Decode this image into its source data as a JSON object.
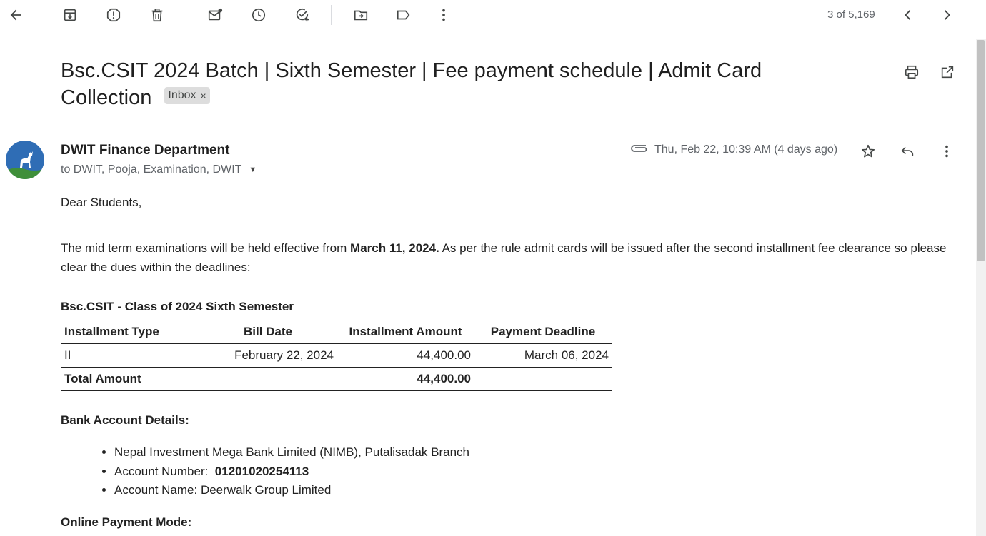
{
  "toolbar": {
    "icons": [
      "back-arrow-icon",
      "archive-icon",
      "report-spam-icon",
      "delete-icon",
      "mark-unread-icon",
      "snooze-icon",
      "add-task-icon",
      "move-to-icon",
      "label-icon",
      "more-vert-icon"
    ],
    "pager_text": "3 of 5,169"
  },
  "email": {
    "subject": "Bsc.CSIT 2024 Batch | Sixth Semester | Fee payment schedule | Admit Card Collection",
    "label": "Inbox",
    "label_close": "×",
    "sender": "DWIT Finance Department",
    "recipients": "to DWIT, Pooja, Examination, DWIT",
    "date": "Thu, Feb 22, 10:39 AM (4 days ago)"
  },
  "content": {
    "greeting": "Dear Students,",
    "para_part1": "The mid term examinations will be held effective from ",
    "para_bold": "March 11, 2024.",
    "para_part2": " As per the rule admit cards will be issued after the second installment fee clearance so please clear the dues within the deadlines:",
    "table_title": "Bsc.CSIT - Class of 2024 Sixth Semester",
    "table": {
      "headers": [
        "Installment Type",
        "Bill Date",
        "Installment Amount",
        "Payment Deadline"
      ],
      "rows": [
        [
          "II",
          "February 22, 2024",
          "44,400.00",
          "March 06, 2024"
        ]
      ],
      "total_label": "Total Amount",
      "total_value": "44,400.00"
    },
    "bank_title": "Bank Account Details:",
    "bank_bank": "Nepal Investment Mega Bank Limited (NIMB), Putalisadak Branch",
    "bank_acct_label": "Account Number:",
    "bank_acct_number": "01201020254113",
    "bank_name": "Account Name: Deerwalk Group Limited",
    "online_title": "Online Payment Mode:"
  },
  "colors": {
    "avatar_bg": "#2f6db5",
    "chip_bg": "#dddddd",
    "icon": "#444746"
  }
}
